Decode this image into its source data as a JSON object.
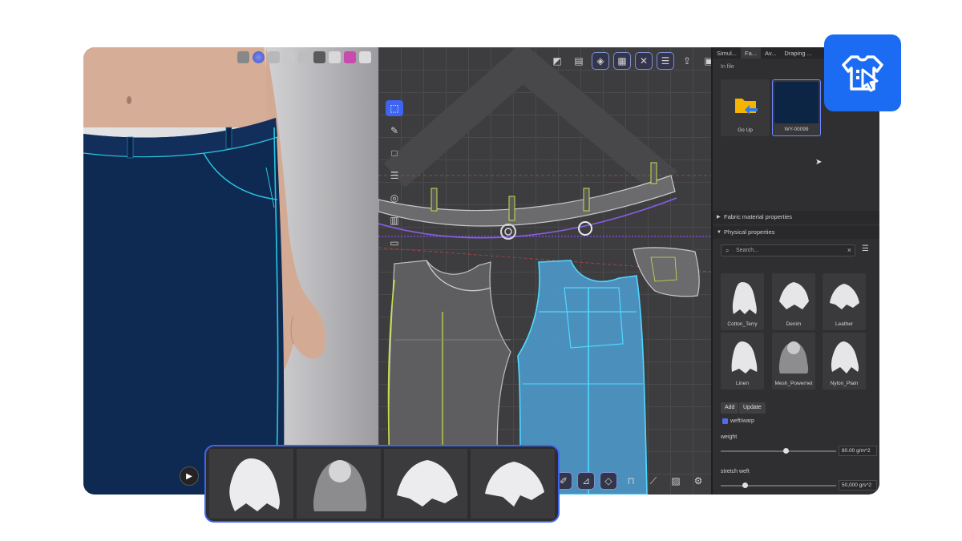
{
  "toolbar3d": {
    "icons": [
      "texture-icon",
      "sphere-icon",
      "layers-icon",
      "avatar-icon",
      "figure-icon",
      "garment-icon",
      "image-icon",
      "pink-image-icon",
      "cube-icon"
    ]
  },
  "toolbar2d": {
    "icons": [
      "pattern-icon",
      "clipboard-icon",
      "tag-icon",
      "grid-icon",
      "scissors-icon",
      "list-icon",
      "export-icon",
      "cube-icon"
    ]
  },
  "sidetools": {
    "icons": [
      "select-icon",
      "pen-icon",
      "rectangle-icon",
      "sewing-icon",
      "button-icon",
      "map-icon",
      "printer-icon"
    ]
  },
  "bottomtools": {
    "icons": [
      "edit-icon",
      "ruler-icon",
      "tag-icon",
      "lock-icon",
      "line-icon",
      "image-icon",
      "settings-icon"
    ]
  },
  "panel": {
    "tabs": [
      "Simul...",
      "Fa...",
      "Av...",
      "Draping ..."
    ],
    "infile_label": "In file",
    "assets": [
      {
        "label": "Go Up"
      },
      {
        "label": "WY-00099"
      }
    ],
    "sections": {
      "fabric_material": "Fabric material properties",
      "physical": "Physical properties"
    },
    "search": {
      "placeholder": "Search..."
    },
    "fabrics": [
      {
        "label": "Cotton_Terry"
      },
      {
        "label": "Denim"
      },
      {
        "label": "Leather"
      },
      {
        "label": "Linen"
      },
      {
        "label": "Mesh_Powernet"
      },
      {
        "label": "Nylon_Plain"
      }
    ],
    "buttons": {
      "add": "Add",
      "update": "Update"
    },
    "weft_warp_label": "weft/warp",
    "weft_warp_checked": true,
    "weight": {
      "label": "weight",
      "value": "80.00 g/m^2",
      "level": 0.56
    },
    "stretch_weft": {
      "label": "stretch weft",
      "value": "50,000 g/s^2",
      "level": 0.21
    }
  },
  "colors": {
    "accent": "#3f64f0",
    "denim": "#0f2a52",
    "seam": "#29c6e0",
    "logo_bg": "#1b6cf2"
  }
}
